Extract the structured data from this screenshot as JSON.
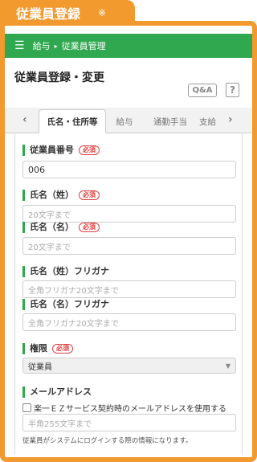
{
  "header_tab": {
    "title": "従業員登録",
    "mark": "※"
  },
  "topbar": {
    "menu_icon": "hamburger-icon",
    "crumbs": [
      "給与",
      "従業員管理"
    ],
    "sep": "▸"
  },
  "page": {
    "title": "従業員登録・変更"
  },
  "buttons": {
    "qa": "Q&A",
    "help": "?"
  },
  "tabs": {
    "prev": "‹",
    "next": "›",
    "items": [
      {
        "label": "氏名・住所等",
        "active": true
      },
      {
        "label": "給与",
        "active": false
      },
      {
        "label": "通勤手当",
        "active": false
      },
      {
        "label": "支給",
        "active": false
      }
    ]
  },
  "required_label": "必須",
  "form": {
    "employee_no": {
      "label": "従業員番号",
      "value": "006"
    },
    "last_name": {
      "label": "氏名（姓）",
      "placeholder": "20文字まで"
    },
    "first_name": {
      "label": "氏名（名）",
      "placeholder": "20文字まで"
    },
    "last_kana": {
      "label": "氏名（姓）フリガナ",
      "placeholder": "全角フリガナ20文字まで"
    },
    "first_kana": {
      "label": "氏名（名）フリガナ",
      "placeholder": "全角フリガナ20文字まで"
    },
    "role": {
      "label": "権限",
      "selected": "従業員",
      "caret": "▼"
    },
    "email": {
      "label": "メールアドレス",
      "checkbox_label": "楽一ＥＺサービス契約時のメールアドレスを使用する",
      "placeholder": "半角255文字まで",
      "note": "従業員がシステムにログインする際の情報になります。"
    }
  },
  "colors": {
    "orange": "#f29a2e",
    "green": "#2fa84f",
    "required_red": "#e04040"
  }
}
